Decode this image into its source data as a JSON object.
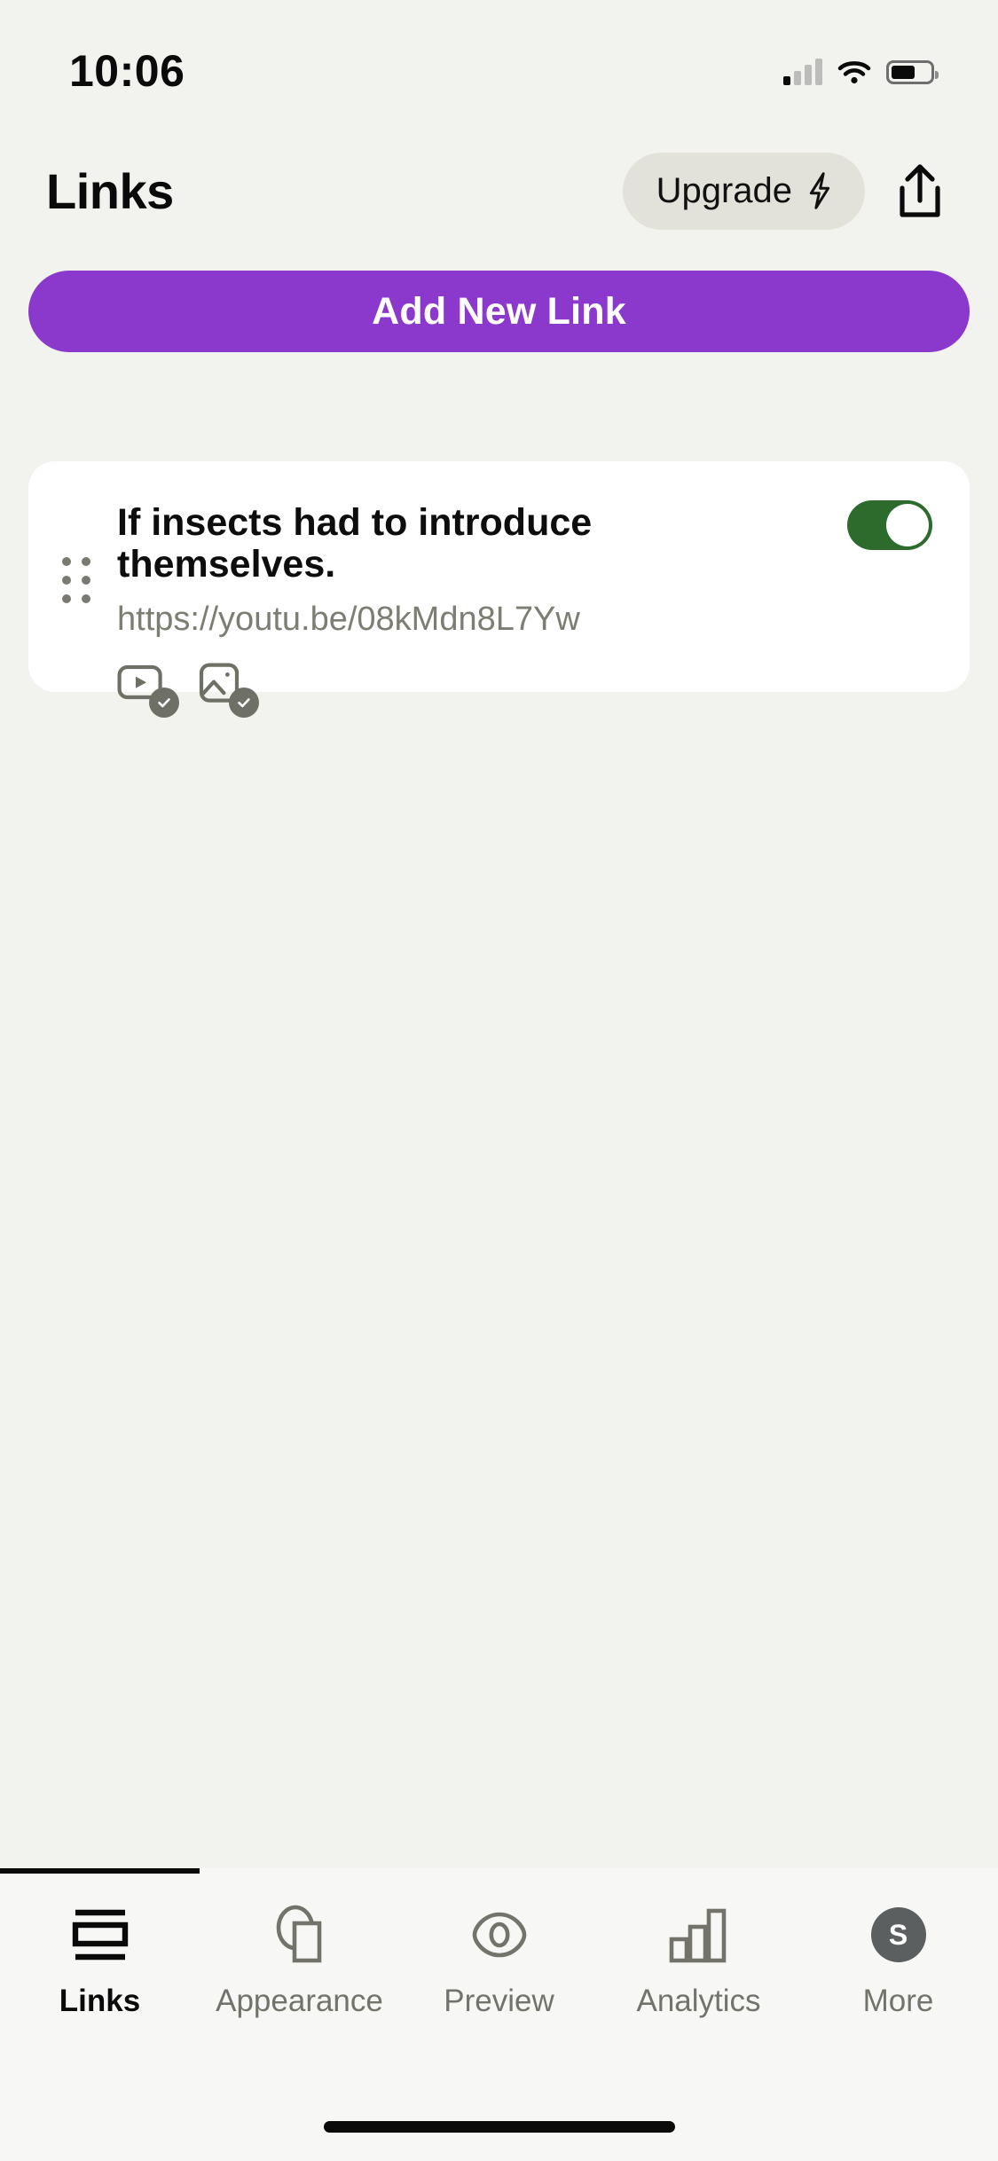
{
  "status_bar": {
    "time": "10:06",
    "cellular_icon": "signal-bars-icon",
    "wifi_icon": "wifi-icon",
    "battery_icon": "battery-icon"
  },
  "header": {
    "title": "Links",
    "upgrade_label": "Upgrade",
    "upgrade_icon": "lightning-bolt-icon",
    "share_icon": "share-upload-icon"
  },
  "primary_action": {
    "label": "Add New Link",
    "color": "#8b38cc"
  },
  "links": [
    {
      "title": "If insects had to introduce themselves.",
      "url": "https://youtu.be/08kMdn8L7Yw",
      "enabled": true,
      "toggle_color": "#2c6b2b",
      "drag_handle_icon": "drag-dots-icon",
      "badges": [
        {
          "icon": "video-thumbnail-icon",
          "state_icon": "check-circle-icon"
        },
        {
          "icon": "image-thumbnail-icon",
          "state_icon": "check-circle-icon"
        }
      ]
    }
  ],
  "tab_bar": {
    "active_index": 0,
    "tabs": [
      {
        "label": "Links",
        "icon": "links-layout-icon"
      },
      {
        "label": "Appearance",
        "icon": "appearance-shapes-icon"
      },
      {
        "label": "Preview",
        "icon": "eye-preview-icon"
      },
      {
        "label": "Analytics",
        "icon": "bar-chart-icon"
      },
      {
        "label": "More",
        "icon": "avatar-icon",
        "avatar_initial": "S"
      }
    ]
  }
}
